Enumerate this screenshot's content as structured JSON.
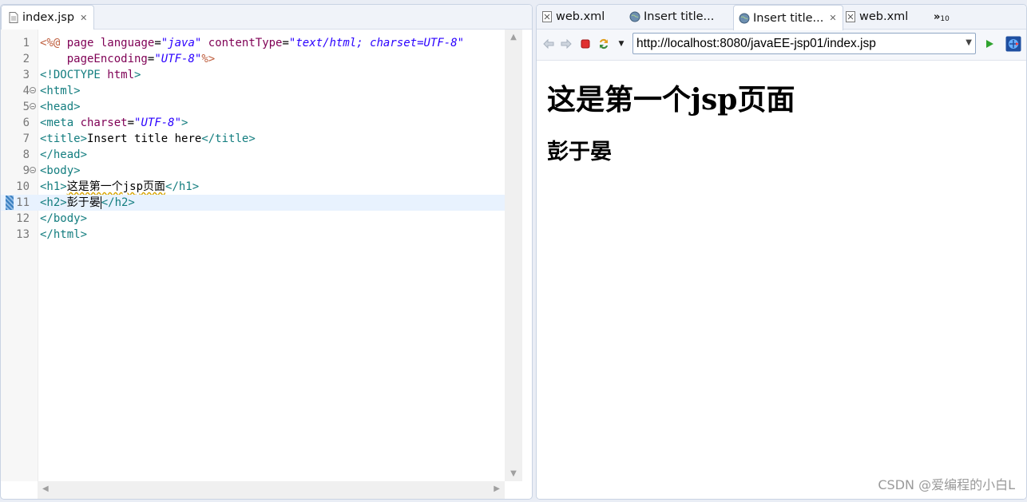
{
  "editor": {
    "tab": {
      "label": "index.jsp"
    },
    "lines": [
      {
        "num": "1",
        "parts": [
          [
            "dir",
            "<%@ "
          ],
          [
            "attr",
            "page "
          ],
          [
            "attr",
            "language"
          ],
          [
            "text",
            "="
          ],
          [
            "val",
            "\"java\""
          ],
          [
            "text",
            " "
          ],
          [
            "attr",
            "contentType"
          ],
          [
            "text",
            "="
          ],
          [
            "val",
            "\"text/html; charset=UTF-8\""
          ]
        ]
      },
      {
        "num": "2",
        "parts": [
          [
            "text",
            "    "
          ],
          [
            "attr",
            "pageEncoding"
          ],
          [
            "text",
            "="
          ],
          [
            "val",
            "\"UTF-8\""
          ],
          [
            "dir",
            "%>"
          ]
        ]
      },
      {
        "num": "3",
        "parts": [
          [
            "tag",
            "<!DOCTYPE "
          ],
          [
            "attr",
            "html"
          ],
          [
            "tag",
            ">"
          ]
        ]
      },
      {
        "num": "4",
        "fold": true,
        "parts": [
          [
            "tag",
            "<html>"
          ]
        ]
      },
      {
        "num": "5",
        "fold": true,
        "parts": [
          [
            "tag",
            "<head>"
          ]
        ]
      },
      {
        "num": "6",
        "parts": [
          [
            "tag",
            "<meta "
          ],
          [
            "attr",
            "charset"
          ],
          [
            "text",
            "="
          ],
          [
            "val",
            "\"UTF-8\""
          ],
          [
            "tag",
            ">"
          ]
        ]
      },
      {
        "num": "7",
        "parts": [
          [
            "tag",
            "<title>"
          ],
          [
            "text",
            "Insert title here"
          ],
          [
            "tag",
            "</title>"
          ]
        ]
      },
      {
        "num": "8",
        "parts": [
          [
            "tag",
            "</head>"
          ]
        ]
      },
      {
        "num": "9",
        "fold": true,
        "parts": [
          [
            "tag",
            "<body>"
          ]
        ]
      },
      {
        "num": "10",
        "parts": [
          [
            "tag",
            "<h1>"
          ],
          [
            "squig",
            "这是第一个jsp页面"
          ],
          [
            "tag",
            "</h1>"
          ]
        ]
      },
      {
        "num": "11",
        "current": true,
        "parts": [
          [
            "tag",
            "<h2>"
          ],
          [
            "text",
            "彭于晏"
          ],
          [
            "caret",
            ""
          ],
          [
            "tag",
            "</h2>"
          ]
        ]
      },
      {
        "num": "12",
        "parts": [
          [
            "tag",
            "</body>"
          ]
        ]
      },
      {
        "num": "13",
        "parts": [
          [
            "tag",
            "</html>"
          ]
        ]
      }
    ]
  },
  "browser": {
    "tabs": [
      {
        "label": "web.xml",
        "icon": "xml-file-icon"
      },
      {
        "label": "Insert title...",
        "icon": "globe-icon"
      },
      {
        "label": "Insert title...",
        "icon": "globe-icon",
        "active": true
      },
      {
        "label": "web.xml",
        "icon": "xml-file-icon"
      }
    ],
    "overflow_label": "»",
    "overflow_count": "10",
    "url": "http://localhost:8080/javaEE-jsp01/index.jsp",
    "page": {
      "h1": "这是第一个jsp页面",
      "h2": "彭于晏"
    }
  },
  "watermark": "CSDN @爱编程的小白L"
}
